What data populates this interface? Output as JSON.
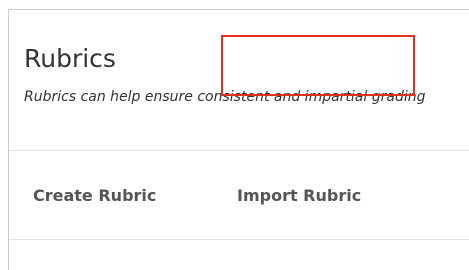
{
  "header": {
    "title": "Rubrics",
    "description": "Rubrics can help ensure consistent and impartial grading"
  },
  "tabs": [
    {
      "label": "Create Rubric"
    },
    {
      "label": "Import Rubric",
      "highlighted": true
    }
  ],
  "colors": {
    "highlight_border": "#e0301e",
    "text": "#333333",
    "tab_text": "#555555",
    "divider": "#e2e2e2"
  }
}
